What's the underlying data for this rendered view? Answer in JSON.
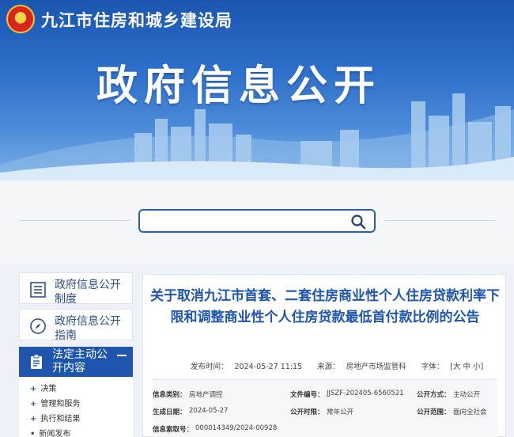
{
  "header": {
    "site_name": "九江市住房和城乡建设局",
    "banner_title": "政府信息公开"
  },
  "search": {
    "placeholder": ""
  },
  "sidebar": {
    "cards": [
      {
        "label": "政府信息公开制度",
        "icon": "document-list-icon"
      },
      {
        "label": "政府信息公开指南",
        "icon": "compass-icon"
      }
    ],
    "active": {
      "label": "法定主动公开内容",
      "icon": "clipboard-icon"
    },
    "sub_items": [
      "决策",
      "管理和服务",
      "执行和结果",
      "新闻发布"
    ]
  },
  "article": {
    "title": "关于取消九江市首套、二套住房商业性个人住房贷款利率下限和调整商业性个人住房贷款最低首付款比例的公告",
    "publish_label": "发布时间：",
    "publish_time": "2024-05-27 11:15",
    "source_label": "来源：",
    "source": "房地产市场监管科",
    "font_label": "字体：",
    "font_sizes": "[大 中 小]",
    "info": {
      "category_label": "信息类别：",
      "category": "房地产调控",
      "doc_no_label": "文件编号：",
      "doc_no": "JJSZF-202405-6560521",
      "method_label": "公开方式：",
      "method": "主动公开",
      "date_label": "生成日期：",
      "date": "2024-05-27",
      "period_label": "公开时限：",
      "period": "常年公开",
      "scope_label": "公开范围：",
      "scope": "面向全社会",
      "index_label": "信息索取号：",
      "index": "000014349/2024-00928"
    }
  },
  "colors": {
    "primary": "#1d56ac",
    "banner": "#2a6cc8"
  }
}
